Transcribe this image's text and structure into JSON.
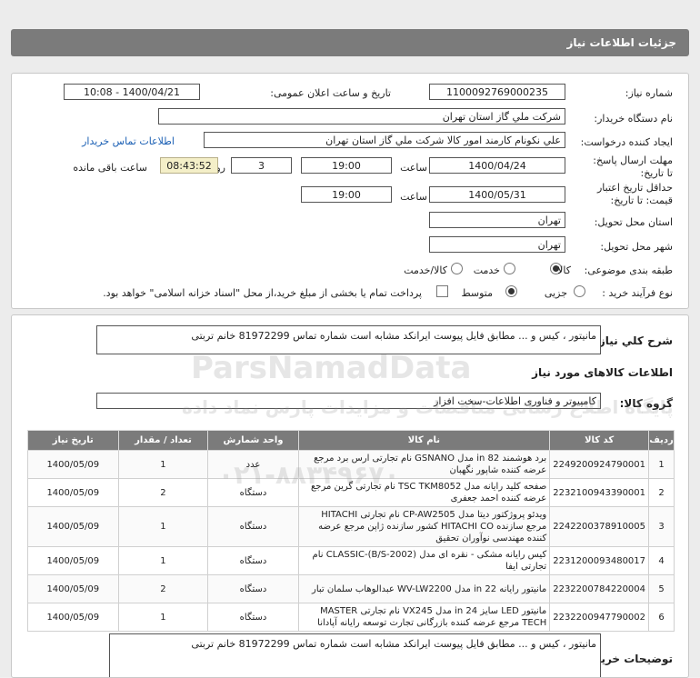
{
  "header": {
    "title": "جزئیات اطلاعات نیاز"
  },
  "form": {
    "need_number_label": "شماره نیاز:",
    "need_number": "1100092769000235",
    "announce_label": "تاریخ و ساعت اعلان عمومی:",
    "announce_value": "1400/04/21 - 10:08",
    "buyer_label": "نام دستگاه خریدار:",
    "buyer_value": "شرکت ملي گاز استان تهران",
    "creator_label": "ایجاد کننده درخواست:",
    "creator_value": "علي نکونام کارمند امور کالا شرکت ملي گاز استان تهران",
    "contact_link": "اطلاعات تماس خریدار",
    "deadline_label": "مهلت ارسال پاسخ: تا تاریخ:",
    "deadline_date": "1400/04/24",
    "time_label": "ساعت",
    "deadline_time": "19:00",
    "days_value": "3",
    "days_label": "روز و",
    "remaining_value": "08:43:52",
    "remaining_label": "ساعت باقی مانده",
    "validity_label": "حداقل تاریخ اعتبار قیمت: تا تاریخ:",
    "validity_date": "1400/05/31",
    "validity_time": "19:00",
    "province_label": "استان محل تحویل:",
    "province_value": "تهران",
    "city_label": "شهر محل تحویل:",
    "city_value": "تهران",
    "category_label": "طبقه بندی موضوعی:",
    "cat_goods": "کالا",
    "cat_service": "خدمت",
    "cat_both": "کالا/خدمت",
    "process_label": "نوع فرآیند خرید :",
    "proc_partial": "جزیی",
    "proc_medium": "متوسط",
    "payment_note": "پرداخت تمام یا بخشی از مبلغ خرید،از محل \"اسناد خزانه اسلامی\" خواهد بود."
  },
  "summary": {
    "label": "شرح کلي نیاز:",
    "value": "مانیتور ، کیس و ... مطابق فایل پیوست ایرانکد مشابه است شماره تماس 81972299 خانم تربتی"
  },
  "goods": {
    "section_title": "اطلاعات کالاهای مورد نیاز",
    "group_label": "گروه کالا:",
    "group_value": "کامپیوتر و فناوری اطلاعات-سخت افزار",
    "columns": [
      "ردیف",
      "کد کالا",
      "نام کالا",
      "واحد شمارش",
      "تعداد / مقدار",
      "تاریخ نیاز"
    ],
    "rows": [
      [
        "1",
        "2249200924790001",
        "برد هوشمند 82 in مدل GSNANO نام تجارتی ارس برد مرجع عرضه کننده شاپور نگهبان",
        "عدد",
        "1",
        "1400/05/09"
      ],
      [
        "2",
        "2232100943390001",
        "صفحه کلید رایانه مدل TSC TKM8052 نام تجارتی گرین مرجع عرضه کننده احمد جعفری",
        "دستگاه",
        "2",
        "1400/05/09"
      ],
      [
        "3",
        "2242200378910005",
        "ویدئو پروژکتور دیتا مدل CP-AW2505 نام تجارتی HITACHI مرجع سازنده HITACHI CO کشور سازنده ژاپن مرجع عرضه کننده مهندسی نوآوران تحقیق",
        "دستگاه",
        "1",
        "1400/05/09"
      ],
      [
        "4",
        "2231200093480017",
        "کیس رایانه مشکی - نقره ای مدل (CLASSIC-(B/S-2002 نام تجارتی ایفا",
        "دستگاه",
        "1",
        "1400/05/09"
      ],
      [
        "5",
        "2232200784220004",
        "مانیتور رایانه 22 in مدل WV-LW2200 عبدالوهاب سلمان تبار",
        "دستگاه",
        "2",
        "1400/05/09"
      ],
      [
        "6",
        "2232200947790002",
        "مانیتور LED سایز 24 in مدل VX245 نام تجارتی MASTER TECH مرجع عرضه کننده بازرگانی تجارت توسعه رایانه آپادانا",
        "دستگاه",
        "1",
        "1400/05/09"
      ]
    ]
  },
  "buyer_notes": {
    "label": "توضیحات خریدار:",
    "value": "مانیتور ، کیس و ... مطابق فایل پیوست ایرانکد مشابه است شماره تماس 81972299 خانم تربتی"
  },
  "watermark": {
    "brand": "ParsNamadData",
    "line1": "پایگاه اطلاع رسانی مناقصات و مزایدات پارس نماد داده",
    "phone": "۰۲۱-۸۸۳۴۹۶۷۰"
  }
}
